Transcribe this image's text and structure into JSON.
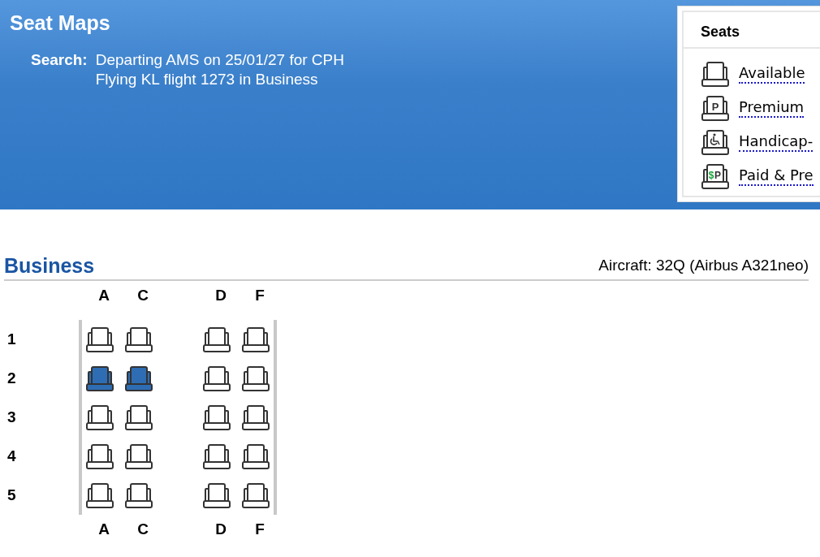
{
  "header": {
    "title": "Seat Maps",
    "search_label": "Search:",
    "search_lines": [
      "Departing AMS on 25/01/27 for CPH",
      "Flying KL flight 1273 in Business"
    ]
  },
  "legend": {
    "title": "Seats",
    "items": [
      {
        "kind": "available",
        "label": "Available"
      },
      {
        "kind": "premium",
        "label": "Premium",
        "badge": "P"
      },
      {
        "kind": "handicap",
        "label": "Handicap-"
      },
      {
        "kind": "paid",
        "label": "Paid & Pre",
        "currency": "$",
        "badge": "P"
      }
    ]
  },
  "cabin": {
    "title": "Business",
    "aircraft": "Aircraft: 32Q (Airbus A321neo)",
    "columns_top": [
      "A",
      "C",
      "D",
      "F"
    ],
    "columns_bottom": [
      "A",
      "C",
      "D",
      "F"
    ],
    "rows": [
      {
        "number": "1",
        "seats": [
          {
            "kind": "available"
          },
          {
            "kind": "available"
          },
          {
            "kind": "available"
          },
          {
            "kind": "available"
          }
        ]
      },
      {
        "number": "2",
        "seats": [
          {
            "kind": "occupied"
          },
          {
            "kind": "occupied"
          },
          {
            "kind": "available"
          },
          {
            "kind": "available"
          }
        ]
      },
      {
        "number": "3",
        "seats": [
          {
            "kind": "available"
          },
          {
            "kind": "available"
          },
          {
            "kind": "available"
          },
          {
            "kind": "available"
          }
        ]
      },
      {
        "number": "4",
        "seats": [
          {
            "kind": "available"
          },
          {
            "kind": "available"
          },
          {
            "kind": "available"
          },
          {
            "kind": "available"
          }
        ]
      },
      {
        "number": "5",
        "seats": [
          {
            "kind": "available"
          },
          {
            "kind": "available"
          },
          {
            "kind": "available"
          },
          {
            "kind": "available"
          }
        ]
      }
    ]
  }
}
